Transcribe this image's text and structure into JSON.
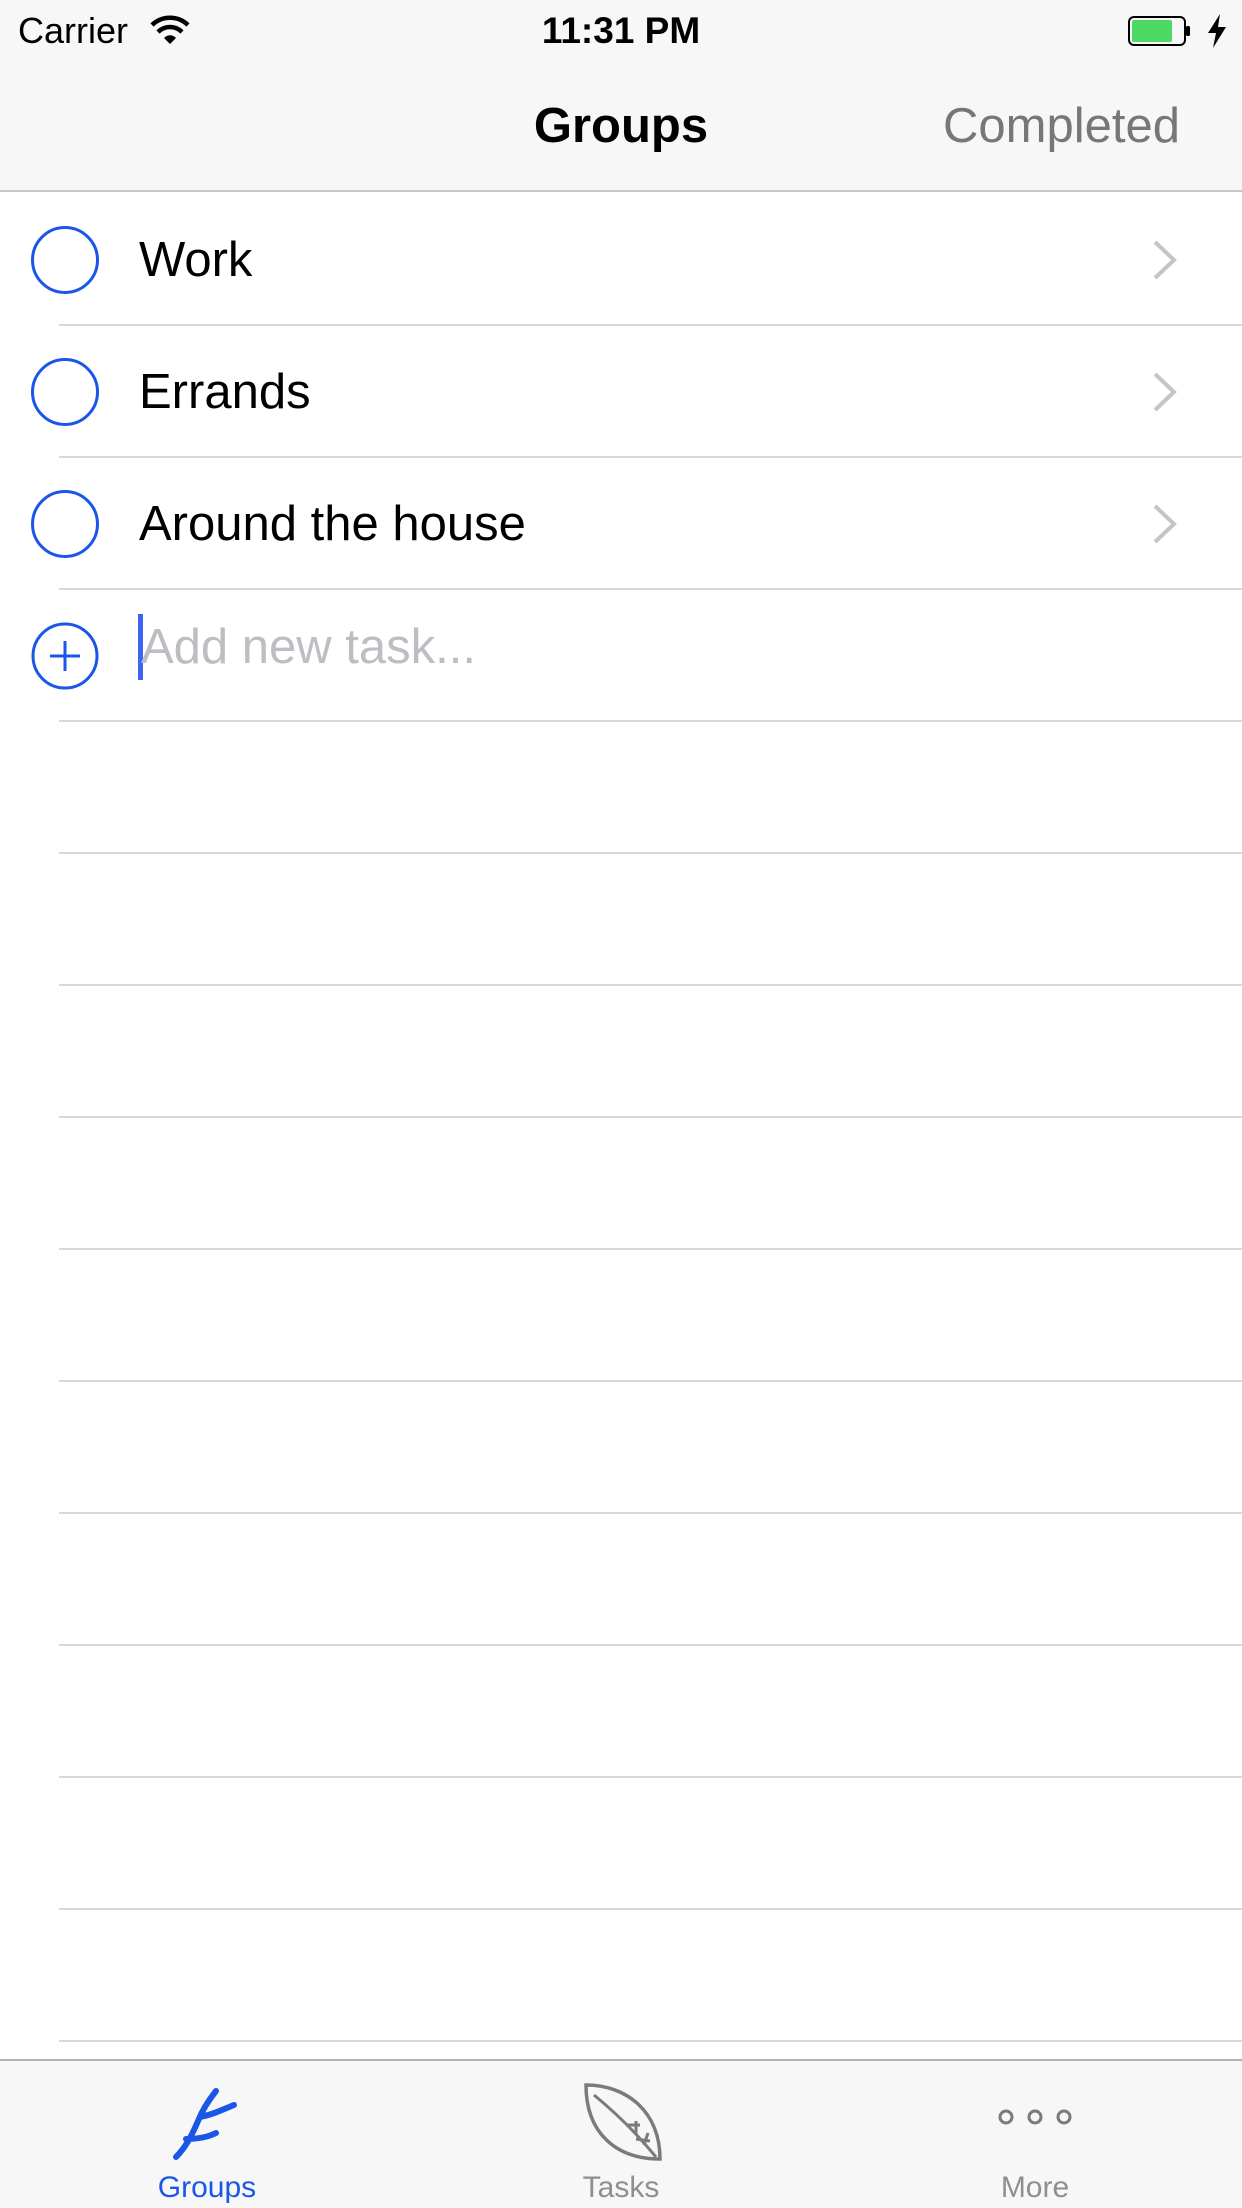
{
  "status_bar": {
    "carrier": "Carrier",
    "time": "11:31 PM",
    "battery_color": "#4cd964"
  },
  "nav": {
    "title": "Groups",
    "right_button": "Completed"
  },
  "groups": [
    {
      "label": "Work"
    },
    {
      "label": "Errands"
    },
    {
      "label": "Around the house"
    }
  ],
  "add_task": {
    "placeholder": "Add new task..."
  },
  "tabs": [
    {
      "label": "Groups",
      "icon": "branch-icon",
      "active": true
    },
    {
      "label": "Tasks",
      "icon": "leaf-icon",
      "active": false
    },
    {
      "label": "More",
      "icon": "more-dots-icon",
      "active": false
    }
  ],
  "colors": {
    "accent": "#1a56e8",
    "inactive": "#8e8e93",
    "separator": "#d9d9de"
  }
}
